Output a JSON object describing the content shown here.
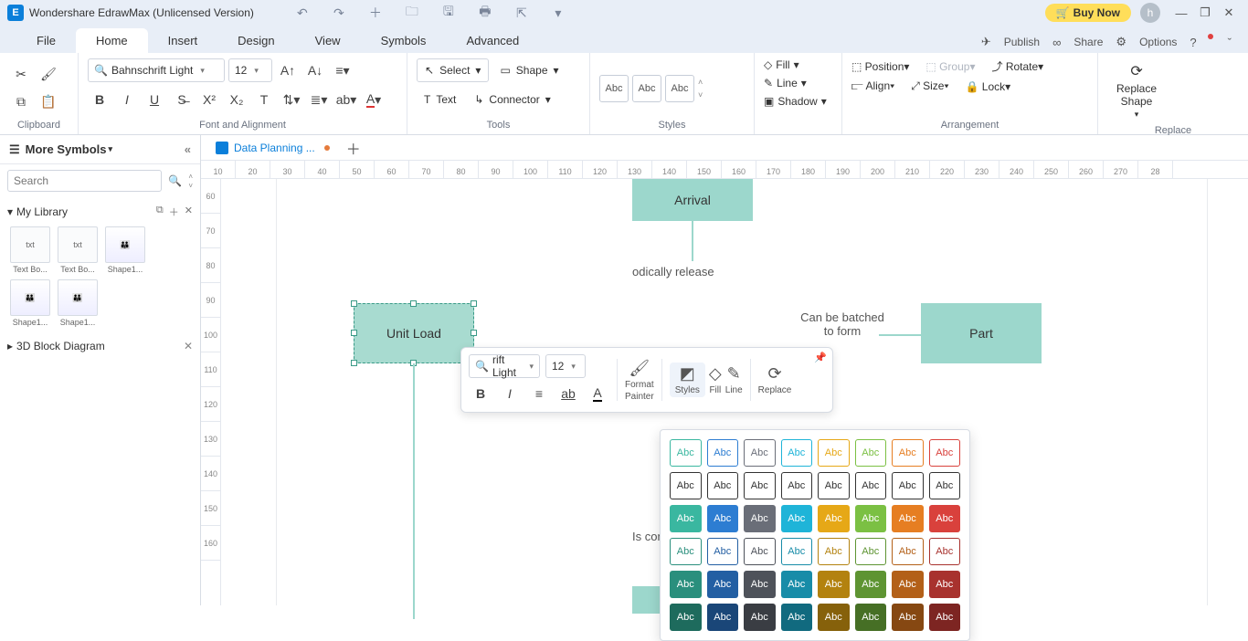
{
  "app": {
    "title": "Wondershare EdrawMax (Unlicensed Version)",
    "buy": "Buy Now",
    "avatar": "h"
  },
  "menu": {
    "file": "File",
    "home": "Home",
    "insert": "Insert",
    "design": "Design",
    "view": "View",
    "symbols": "Symbols",
    "advanced": "Advanced",
    "publish": "Publish",
    "share": "Share",
    "options": "Options"
  },
  "ribbon": {
    "clipboard": "Clipboard",
    "fontAlign": "Font and Alignment",
    "tools": "Tools",
    "styles": "Styles",
    "arrangement": "Arrangement",
    "replace": "Replace",
    "fontName": "Bahnschrift Light",
    "fontSize": "12",
    "select": "Select",
    "shape": "Shape",
    "text": "Text",
    "connector": "Connector",
    "abc": "Abc",
    "fill": "Fill",
    "line": "Line",
    "shadow": "Shadow",
    "position": "Position",
    "align": "Align",
    "group": "Group",
    "size": "Size",
    "rotate": "Rotate",
    "lock": "Lock",
    "replaceShape": "Replace\nShape"
  },
  "left": {
    "more": "More Symbols",
    "search": "Search",
    "mylib": "My Library",
    "thumbs": [
      "Text Bo...",
      "Text Bo...",
      "Shape1...",
      "Shape1...",
      "Shape1..."
    ],
    "cat3d": "3D Block Diagram"
  },
  "doc": {
    "tab": "Data Planning ..."
  },
  "canvas": {
    "unitload": "Unit Load",
    "arrival": "Arrival",
    "part": "Part",
    "periodically": "odically release",
    "batched1": "Can be batched",
    "batched2": "to form",
    "composed": "Is composed of"
  },
  "mini": {
    "font": "rift Light",
    "size": "12",
    "format1": "Format",
    "format2": "Painter",
    "styles": "Styles",
    "fill": "Fill",
    "line": "Line",
    "replace": "Replace"
  },
  "swatch": {
    "abc": "Abc"
  },
  "hruler": [
    "10",
    "20",
    "30",
    "40",
    "50",
    "60",
    "70",
    "80",
    "90",
    "100",
    "110",
    "120",
    "130",
    "140",
    "150",
    "160",
    "170",
    "180",
    "190",
    "200",
    "210",
    "220",
    "230",
    "240",
    "250",
    "260",
    "270",
    "28"
  ],
  "vruler": [
    "60",
    "70",
    "80",
    "90",
    "100",
    "110",
    "120",
    "130",
    "140",
    "150",
    "160"
  ],
  "styleColors": {
    "row1_border": [
      "#3ab7a0",
      "#2d7dd2",
      "#6a6e78",
      "#1fb4d8",
      "#e6a817",
      "#7bc043",
      "#e67e22",
      "#d9413c"
    ],
    "row3_fill": [
      "#3ab7a0",
      "#2d7dd2",
      "#6a6e78",
      "#1fb4d8",
      "#e6a817",
      "#7bc043",
      "#e67e22",
      "#d9413c"
    ],
    "row4_border": [
      "#2a8f7d",
      "#235fa3",
      "#4e525a",
      "#188ca8",
      "#b3820f",
      "#5e9432",
      "#b36018",
      "#a8322e"
    ],
    "row5_fill": [
      "#2a8f7d",
      "#235fa3",
      "#4e525a",
      "#188ca8",
      "#b3820f",
      "#5e9432",
      "#b36018",
      "#a8322e"
    ],
    "row6_fill": [
      "#1e6b5d",
      "#1a4678",
      "#3a3d43",
      "#116a7f",
      "#86610b",
      "#466f25",
      "#864812",
      "#7d2522"
    ]
  }
}
